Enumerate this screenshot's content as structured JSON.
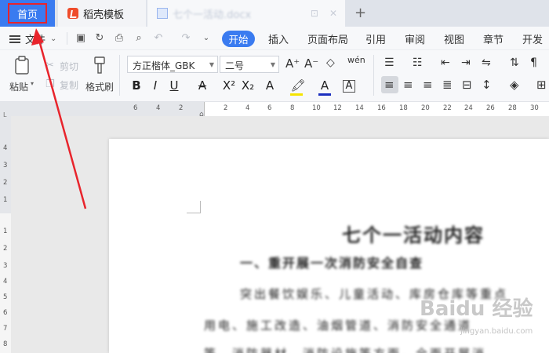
{
  "tabs": {
    "home": "首页",
    "template": "稻壳模板",
    "file": "七个一活动.docx"
  },
  "menu": {
    "file": "文件",
    "items": [
      "开始",
      "插入",
      "页面布局",
      "引用",
      "审阅",
      "视图",
      "章节",
      "开发工"
    ]
  },
  "ribbon": {
    "paste": "粘贴",
    "cut": "剪切",
    "copy": "复制",
    "format_painter": "格式刷",
    "font_name": "方正楷体_GBK",
    "font_size": "二号"
  },
  "ruler": {
    "top_ticks": [
      "6",
      "4",
      "2",
      "2",
      "4",
      "6",
      "8",
      "10",
      "12",
      "14",
      "16",
      "18",
      "20",
      "22",
      "24",
      "26",
      "28",
      "30",
      "32"
    ],
    "left_ticks": [
      "4",
      "3",
      "2",
      "1",
      "1",
      "2",
      "3",
      "4",
      "5",
      "6",
      "7",
      "8",
      "9"
    ]
  },
  "document": {
    "title": "七个一活动内容",
    "heading": "一、重开展一次消防安全自查",
    "lines": [
      "突出餐饮娱乐、儿童活动、库房仓库等重点",
      "用电、施工改造、油烟管道、消防安全通道",
      "等、消防器材、消防设施等方面，全面开展消"
    ]
  },
  "watermark": {
    "brand": "Baidu 经验",
    "url": "jingyan.baidu.com"
  },
  "colors": {
    "accent": "#3a7bf0",
    "annotation": "#e8242c"
  }
}
